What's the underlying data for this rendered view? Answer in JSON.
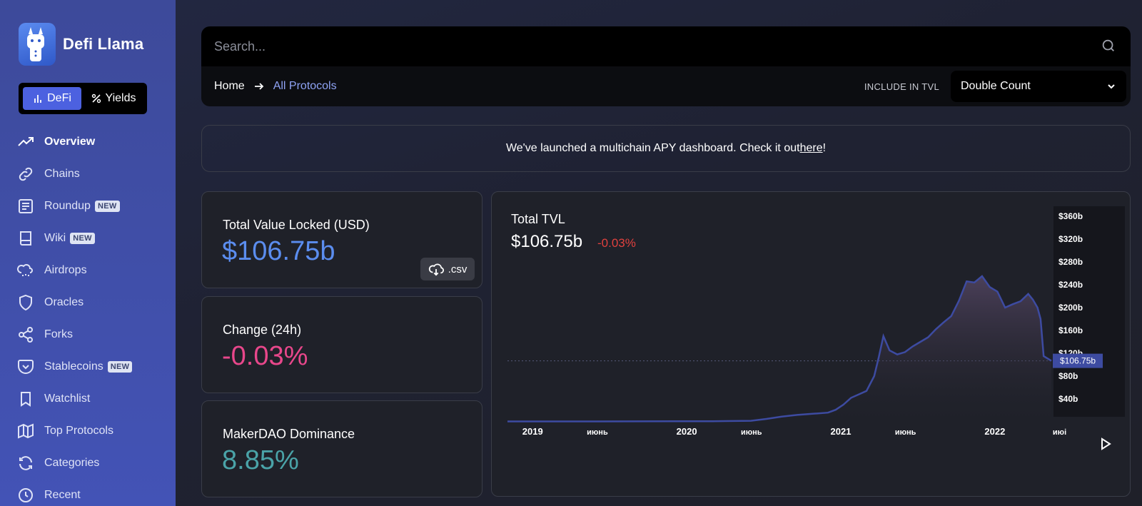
{
  "app": {
    "name": "Defi Llama"
  },
  "switcher": {
    "defi_label": "DeFi",
    "yields_label": "Yields"
  },
  "nav": {
    "items": [
      {
        "label": "Overview",
        "icon": "trending-up-icon",
        "active": true,
        "badge": ""
      },
      {
        "label": "Chains",
        "icon": "link-icon",
        "active": false,
        "badge": ""
      },
      {
        "label": "Roundup",
        "icon": "newspaper-icon",
        "active": false,
        "badge": "NEW"
      },
      {
        "label": "Wiki",
        "icon": "book-icon",
        "active": false,
        "badge": "NEW"
      },
      {
        "label": "Airdrops",
        "icon": "cloud-drizzle-icon",
        "active": false,
        "badge": ""
      },
      {
        "label": "Oracles",
        "icon": "shield-icon",
        "active": false,
        "badge": ""
      },
      {
        "label": "Forks",
        "icon": "share-icon",
        "active": false,
        "badge": ""
      },
      {
        "label": "Stablecoins",
        "icon": "pocket-icon",
        "active": false,
        "badge": "NEW"
      },
      {
        "label": "Watchlist",
        "icon": "bookmark-icon",
        "active": false,
        "badge": ""
      },
      {
        "label": "Top Protocols",
        "icon": "map-icon",
        "active": false,
        "badge": ""
      },
      {
        "label": "Categories",
        "icon": "refresh-icon",
        "active": false,
        "badge": ""
      },
      {
        "label": "Recent",
        "icon": "clock-icon",
        "active": false,
        "badge": ""
      }
    ]
  },
  "search": {
    "placeholder": "Search..."
  },
  "breadcrumb": {
    "home": "Home",
    "current": "All Protocols"
  },
  "tvl_filter": {
    "label": "INCLUDE IN TVL",
    "selected": "Double Count"
  },
  "announcement": {
    "text": "We've launched a multichain APY dashboard. Check it out ",
    "link_text": "here",
    "suffix": "!"
  },
  "stats": {
    "tvl_label": "Total Value Locked (USD)",
    "tvl_value": "$106.75b",
    "csv_label": ".csv",
    "change_label": "Change (24h)",
    "change_value": "-0.03%",
    "dominance_label": "MakerDAO Dominance",
    "dominance_value": "8.85%"
  },
  "colors": {
    "accent": "#4c61e0",
    "tvl_value": "#5b8def",
    "change_value": "#e8478b",
    "dominance_value": "#4aa3a8",
    "chart_line": "#3d4ba1",
    "negative": "#e0413e"
  },
  "chart_data": {
    "type": "area",
    "title": "Total TVL",
    "current_value": "$106.75b",
    "change": "-0.03%",
    "y_ticks": [
      "$40b",
      "$80b",
      "$120b",
      "$160b",
      "$200b",
      "$240b",
      "$280b",
      "$320b",
      "$360b"
    ],
    "ylim": [
      0,
      360
    ],
    "x_ticks": [
      "2019",
      "июнь",
      "2020",
      "июнь",
      "2021",
      "июнь",
      "2022",
      "июі"
    ],
    "price_label": "$106.75b",
    "series": [
      {
        "x": [
          2018.92,
          2019.0,
          2019.25,
          2019.5,
          2019.75,
          2020.0,
          2020.25,
          2020.5,
          2020.6,
          2020.7,
          2020.8,
          2020.9,
          2021.0,
          2021.05,
          2021.1,
          2021.15,
          2021.2,
          2021.25,
          2021.3,
          2021.33,
          2021.36,
          2021.4,
          2021.45,
          2021.5,
          2021.55,
          2021.6,
          2021.65,
          2021.7,
          2021.75,
          2021.8,
          2021.85,
          2021.9,
          2021.95,
          2022.0,
          2022.05,
          2022.1,
          2022.15,
          2022.2,
          2022.25,
          2022.3,
          2022.33,
          2022.36,
          2022.38,
          2022.4,
          2022.45
        ],
        "y": [
          0.6,
          0.6,
          0.6,
          0.6,
          0.7,
          0.9,
          1.0,
          1.7,
          5.0,
          9.0,
          12.0,
          14.0,
          16.0,
          21.0,
          30.0,
          42.0,
          48.0,
          54.0,
          80.0,
          113.0,
          150.0,
          125.0,
          118.0,
          122.0,
          132.0,
          140.0,
          148.0,
          162.0,
          174.0,
          185.0,
          212.0,
          246.0,
          244.0,
          255.0,
          236.0,
          228.0,
          200.0,
          206.0,
          211.0,
          224.0,
          214.0,
          200.0,
          180.0,
          115.0,
          106.75
        ]
      }
    ]
  }
}
